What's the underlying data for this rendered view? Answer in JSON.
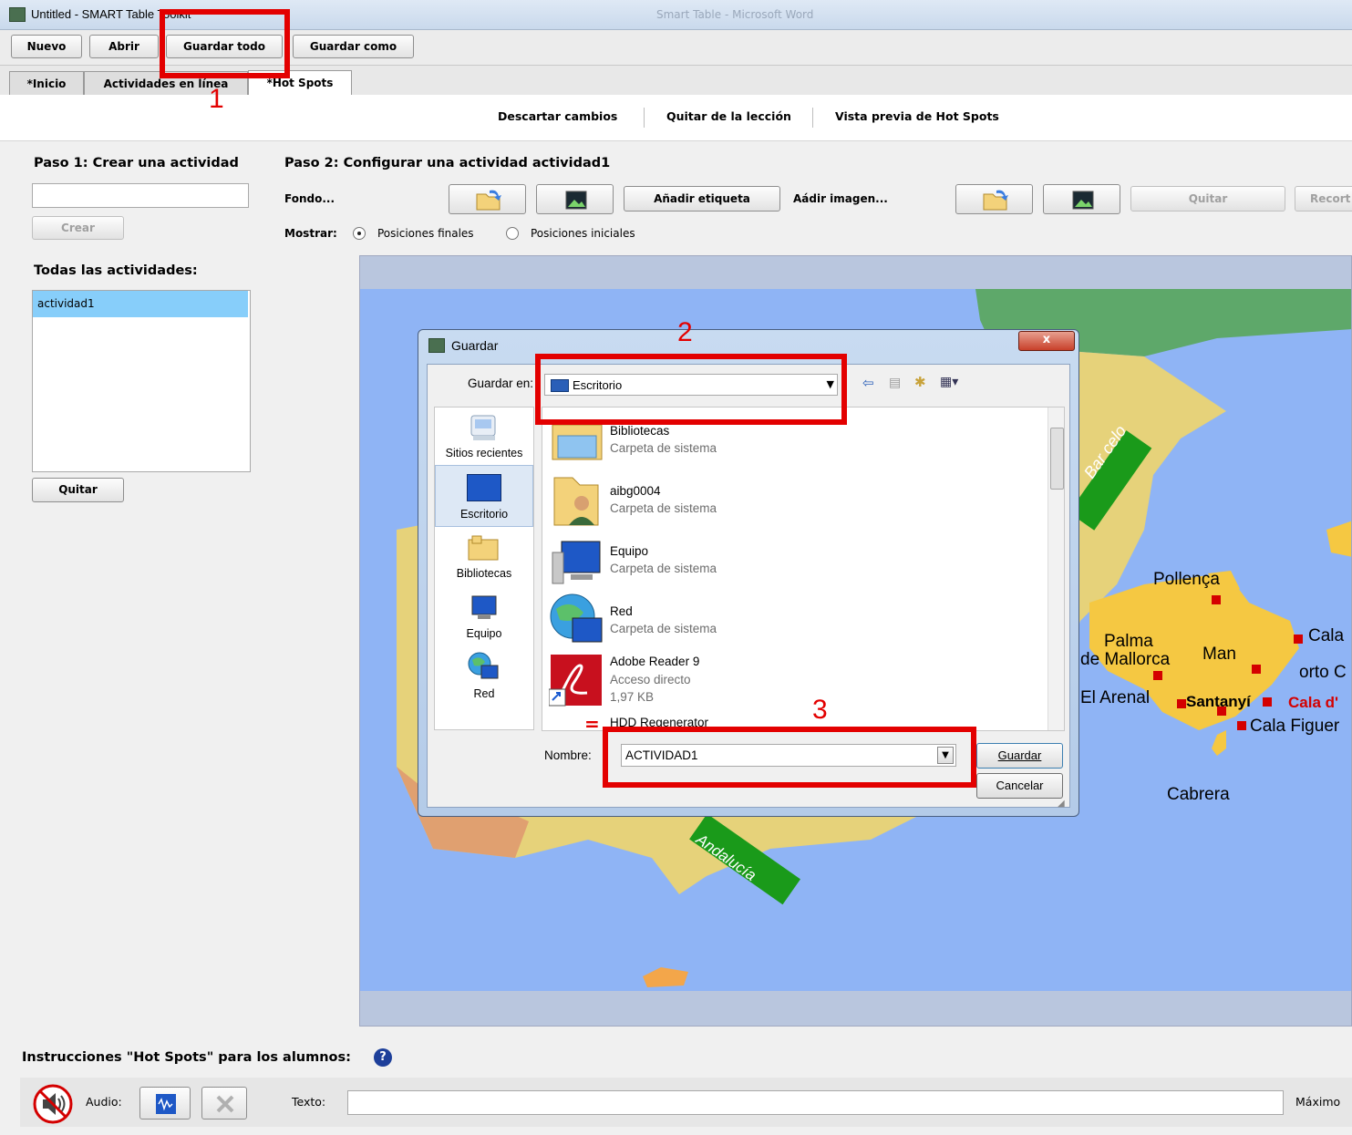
{
  "window": {
    "title": "Untitled - SMART Table Toolkit",
    "bg_title": "Smart Table - Microsoft Word"
  },
  "toolbar": {
    "nuevo": "Nuevo",
    "abrir": "Abrir",
    "guardar_todo": "Guardar todo",
    "guardar_como": "Guardar como"
  },
  "tabs": [
    {
      "label": "*Inicio"
    },
    {
      "label": "Actividades en línea"
    },
    {
      "label": "*Hot Spots"
    }
  ],
  "actions": {
    "descartar": "Descartar cambios",
    "quitar_leccion": "Quitar de la lección",
    "vista_previa": "Vista previa de Hot Spots"
  },
  "left": {
    "paso1": "Paso 1: Crear una actividad",
    "crear": "Crear",
    "todas": "Todas las actividades:",
    "activities": [
      "actividad1"
    ],
    "quitar": "Quitar"
  },
  "main": {
    "paso2": "Paso 2: Configurar una actividad actividad1",
    "fondo": "Fondo...",
    "anadir_etiqueta": "Añadir etiqueta",
    "anadir_imagen": "Aádir imagen...",
    "quitar": "Quitar",
    "recortar": "Recort",
    "mostrar": "Mostrar:",
    "pos_finales": "Posiciones finales",
    "pos_iniciales": "Posiciones iniciales",
    "selected_mode": "Posiciones finales"
  },
  "map_labels": {
    "barcelona": "Bar celo",
    "andalucia": "Andalucía",
    "pollenca": "Pollença",
    "palma1": "Palma",
    "palma2": "de Mallorca",
    "manacor": "Man",
    "cala": "Cala",
    "porto": "orto C",
    "arenal": "El Arenal",
    "santanyi": "Santanyí",
    "cala_d": "Cala d'",
    "cala_figuera": "Cala Figuer",
    "cabrera": "Cabrera"
  },
  "dialog": {
    "title": "Guardar",
    "guardar_en_label": "Guardar en:",
    "guardar_en_value": "Escritorio",
    "places": [
      "Sitios recientes",
      "Escritorio",
      "Bibliotecas",
      "Equipo",
      "Red"
    ],
    "files": [
      {
        "name": "Bibliotecas",
        "sub": "Carpeta de sistema",
        "icon": "libraries-icon"
      },
      {
        "name": "aibg0004",
        "sub": "Carpeta de sistema",
        "icon": "user-folder-icon"
      },
      {
        "name": "Equipo",
        "sub": "Carpeta de sistema",
        "icon": "computer-icon"
      },
      {
        "name": "Red",
        "sub": "Carpeta de sistema",
        "icon": "network-icon"
      },
      {
        "name": "Adobe Reader 9",
        "sub": "Acceso directo",
        "sub2": "1,97 KB",
        "icon": "adobe-reader-icon"
      },
      {
        "name": "HDD Regenerator",
        "sub": "",
        "icon": "app-icon"
      }
    ],
    "nombre_label": "Nombre:",
    "nombre_value": "ACTIVIDAD1",
    "guardar_btn": "Guardar",
    "cancelar_btn": "Cancelar",
    "close": "x"
  },
  "annotations": {
    "n1": "1",
    "n2": "2",
    "n3": "3",
    "dash": "="
  },
  "bottom": {
    "instrucciones": "Instrucciones \"Hot Spots\" para los alumnos:",
    "audio": "Audio:",
    "texto": "Texto:",
    "maximo": "Máximo"
  },
  "colors": {
    "accent_red": "#e30000",
    "sea": "#8fb4f5",
    "land_yellow": "#f5c842",
    "land_tan": "#e6d27a",
    "green_label": "#1a9a1a"
  }
}
